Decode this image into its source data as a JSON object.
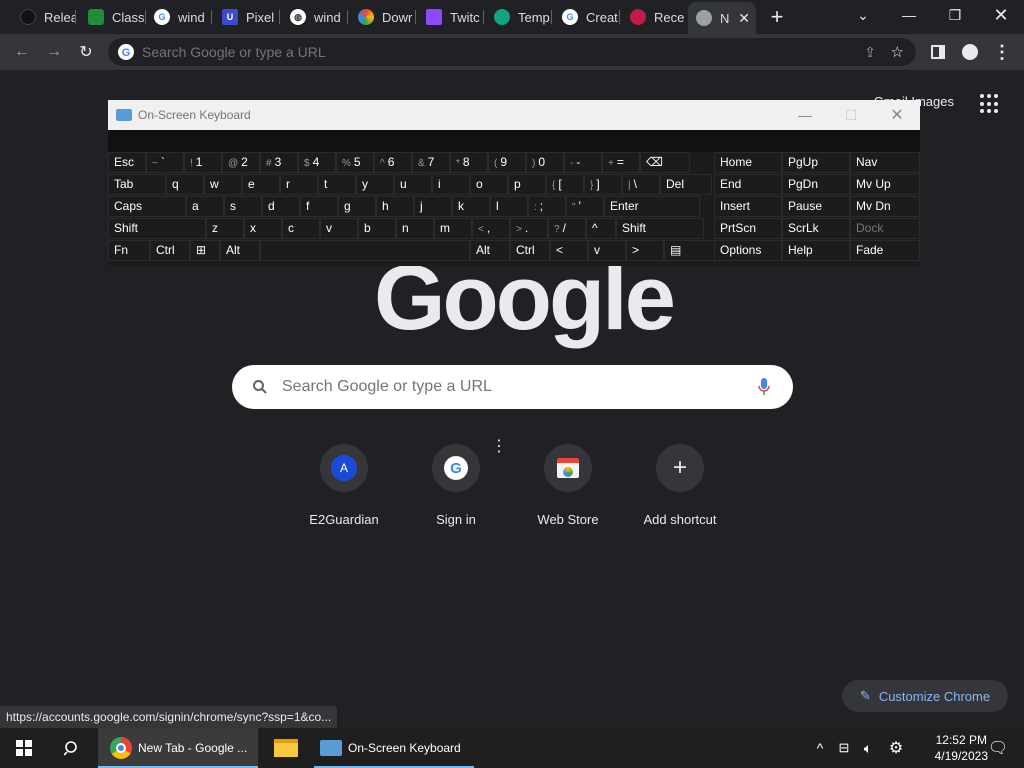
{
  "tabs": [
    {
      "label": "Relea",
      "icon": "github-icon",
      "color": "#222222"
    },
    {
      "label": "Class",
      "icon": "classroom-icon",
      "color": "#1e8e3e"
    },
    {
      "label": "wind",
      "icon": "google-icon",
      "color": "#4285f4"
    },
    {
      "label": "Pixel",
      "icon": "u-logo-icon",
      "color": "#3b4cca"
    },
    {
      "label": "wind",
      "icon": "globe-icon",
      "color": "#9aa0a6"
    },
    {
      "label": "Dowr",
      "icon": "colorwheel-icon",
      "color": "#e8710a"
    },
    {
      "label": "Twitc",
      "icon": "twitch-icon",
      "color": "#9146ff"
    },
    {
      "label": "Temp",
      "icon": "template-icon",
      "color": "#12a37f"
    },
    {
      "label": "Creat",
      "icon": "google-icon",
      "color": "#4285f4"
    },
    {
      "label": "Rece",
      "icon": "raspberry-icon",
      "color": "#c51a4a"
    },
    {
      "label": "N",
      "icon": "chrome-icon",
      "color": "#9aa0a6"
    }
  ],
  "omnibox": {
    "placeholder": "Search Google or type a URL"
  },
  "ntp": {
    "toplinks": "Gmail  Images",
    "logo": "Google",
    "search_placeholder": "Search Google or type a URL",
    "shortcuts": [
      {
        "label": "E2Guardian",
        "initial": "A"
      },
      {
        "label": "Sign in",
        "initial": "G"
      },
      {
        "label": "Web Store",
        "initial": ""
      },
      {
        "label": "Add shortcut",
        "initial": "+"
      }
    ],
    "customize": "Customize Chrome"
  },
  "status_url": "https://accounts.google.com/signin/chrome/sync?ssp=1&co...",
  "osk": {
    "title": "On-Screen Keyboard",
    "rows": [
      [
        "Esc",
        "~ `",
        "! 1",
        "@ 2",
        "# 3",
        "$ 4",
        "% 5",
        "^ 6",
        "& 7",
        "* 8",
        "( 9",
        ") 0",
        "- -",
        "+ =",
        "⌫"
      ],
      [
        "Tab",
        "q",
        "w",
        "e",
        "r",
        "t",
        "y",
        "u",
        "i",
        "o",
        "p",
        "{ [",
        "} ]",
        "| \\",
        "Del"
      ],
      [
        "Caps",
        "a",
        "s",
        "d",
        "f",
        "g",
        "h",
        "j",
        "k",
        "l",
        ": ;",
        "\" '",
        "Enter"
      ],
      [
        "Shift",
        "z",
        "x",
        "c",
        "v",
        "b",
        "n",
        "m",
        "< ,",
        "> .",
        "? /",
        "^",
        "Shift"
      ],
      [
        "Fn",
        "Ctrl",
        "⊞",
        "Alt",
        "",
        "Alt",
        "Ctrl",
        "<",
        "v",
        ">",
        "▤"
      ]
    ],
    "nav": [
      [
        "Home",
        "PgUp",
        "Nav"
      ],
      [
        "End",
        "PgDn",
        "Mv Up"
      ],
      [
        "Insert",
        "Pause",
        "Mv Dn"
      ],
      [
        "PrtScn",
        "ScrLk",
        "Dock"
      ],
      [
        "Options",
        "Help",
        "Fade"
      ]
    ]
  },
  "taskbar": {
    "items": [
      {
        "label": "New Tab - Google ..."
      },
      {
        "label": ""
      },
      {
        "label": "On-Screen Keyboard"
      }
    ],
    "time": "12:52 PM",
    "date": "4/19/2023"
  }
}
